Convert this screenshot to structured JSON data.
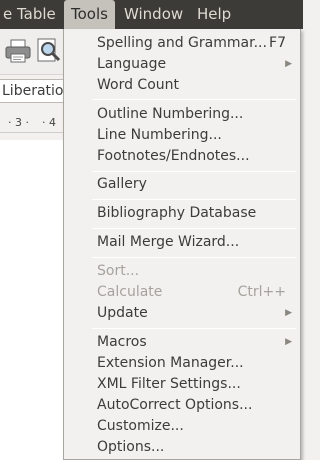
{
  "menubar": {
    "items": [
      {
        "label": "e",
        "underline": ""
      },
      {
        "label": "Table",
        "underline": "a"
      },
      {
        "label": "Tools",
        "underline": "T"
      },
      {
        "label": "Window",
        "underline": "W"
      },
      {
        "label": "Help",
        "underline": "H"
      }
    ]
  },
  "toolbar": {
    "font_name": "Liberatio",
    "ruler_marks": [
      "· 3 ·",
      "· 4"
    ]
  },
  "tools_menu": {
    "items": [
      {
        "label": "Spelling and Grammar...",
        "shortcut": "F7",
        "enabled": true
      },
      {
        "label": "Language",
        "submenu": true,
        "enabled": true
      },
      {
        "label": "Word Count",
        "enabled": true
      },
      {
        "label": "Outline Numbering...",
        "enabled": true
      },
      {
        "label": "Line Numbering...",
        "enabled": true
      },
      {
        "label": "Footnotes/Endnotes...",
        "enabled": true
      },
      {
        "label": "Gallery",
        "enabled": true
      },
      {
        "label": "Bibliography Database",
        "enabled": true
      },
      {
        "label": "Mail Merge Wizard...",
        "enabled": true
      },
      {
        "label": "Sort...",
        "enabled": false
      },
      {
        "label": "Calculate",
        "shortcut": "Ctrl++",
        "enabled": false
      },
      {
        "label": "Update",
        "submenu": true,
        "enabled": true
      },
      {
        "label": "Macros",
        "submenu": true,
        "enabled": true
      },
      {
        "label": "Extension Manager...",
        "enabled": true
      },
      {
        "label": "XML Filter Settings...",
        "enabled": true
      },
      {
        "label": "AutoCorrect Options...",
        "enabled": true
      },
      {
        "label": "Customize...",
        "enabled": true
      },
      {
        "label": "Options...",
        "enabled": true
      }
    ]
  },
  "colors": {
    "menubar_bg": "#3c3b37",
    "menu_bg": "#f2f1f0",
    "disabled_text": "#a6a39d"
  }
}
